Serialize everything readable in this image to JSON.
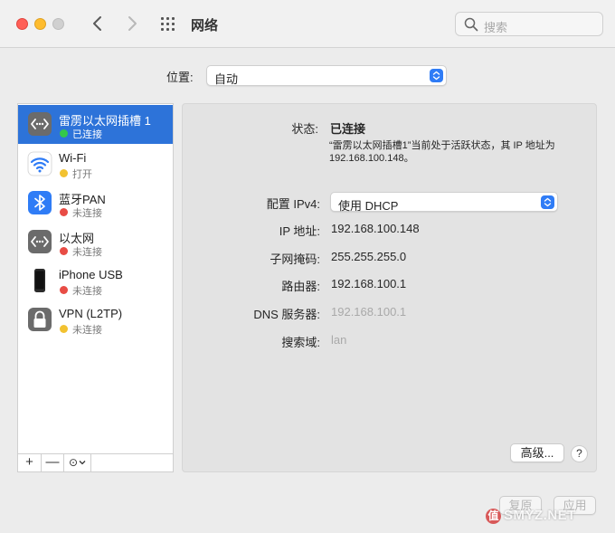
{
  "window": {
    "title": "网络",
    "search_placeholder": "搜索"
  },
  "location": {
    "label": "位置:",
    "value": "自动"
  },
  "services": [
    {
      "name": "雷雳以太网插槽 1",
      "status": "已连接",
      "status_color": "#34c84a",
      "icon": "ethernet-icon",
      "selected": true
    },
    {
      "name": "Wi-Fi",
      "status": "打开",
      "status_color": "#f2c231",
      "icon": "wifi-icon",
      "selected": false
    },
    {
      "name": "蓝牙PAN",
      "status": "未连接",
      "status_color": "#e84c45",
      "icon": "bluetooth-icon",
      "selected": false
    },
    {
      "name": "以太网",
      "status": "未连接",
      "status_color": "#e84c45",
      "icon": "ethernet-icon",
      "selected": false
    },
    {
      "name": "iPhone USB",
      "status": "未连接",
      "status_color": "#e84c45",
      "icon": "iphone-icon",
      "selected": false
    },
    {
      "name": "VPN (L2TP)",
      "status": "未连接",
      "status_color": "#f2c231",
      "icon": "lock-icon",
      "selected": false
    }
  ],
  "sidebar_tools": {
    "add": "+",
    "remove": "—",
    "action": "⊙"
  },
  "detail": {
    "status_label": "状态:",
    "status_value": "已连接",
    "status_description": "“雷雳以太网插槽1”当前处于活跃状态，其 IP 地址为 192.168.100.148。",
    "ipv4_label": "配置 IPv4:",
    "ipv4_value": "使用 DHCP",
    "ip_label": "IP 地址:",
    "ip_value": "192.168.100.148",
    "subnet_label": "子网掩码:",
    "subnet_value": "255.255.255.0",
    "router_label": "路由器:",
    "router_value": "192.168.100.1",
    "dns_label": "DNS 服务器:",
    "dns_value": "192.168.100.1",
    "search_domain_label": "搜索域:",
    "search_domain_value": "lan",
    "advanced_button": "高级...",
    "help_button": "?"
  },
  "footer": {
    "revert_button": "复原",
    "apply_button": "应用"
  },
  "watermark": {
    "badge": "值",
    "text": "SMYZ.NET"
  },
  "colors": {
    "selection": "#2d73d9",
    "accent": "#2f7cf6"
  }
}
